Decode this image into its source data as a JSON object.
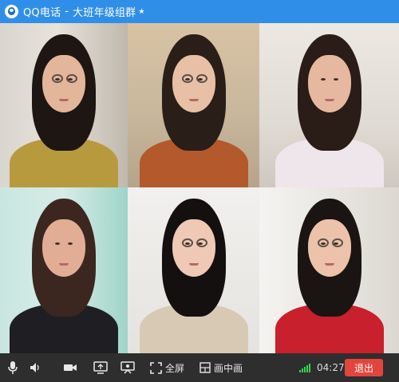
{
  "window": {
    "app_name": "QQ电话",
    "separator": "-",
    "group_name": "大班年级组群",
    "star": "★"
  },
  "participants": [
    {
      "slot": 1,
      "hair": "#1d1612",
      "skin": "#e3b59a",
      "clothes": "#b89a3e",
      "glasses": true
    },
    {
      "slot": 2,
      "hair": "#2a1e18",
      "skin": "#e8c0a6",
      "clothes": "#b4592b",
      "glasses": true
    },
    {
      "slot": 3,
      "hair": "#2a1c16",
      "skin": "#e6b8a0",
      "clothes": "#efe6ec",
      "glasses": false
    },
    {
      "slot": 4,
      "hair": "#3b2720",
      "skin": "#e1ae95",
      "clothes": "#1f1f23",
      "glasses": false
    },
    {
      "slot": 5,
      "hair": "#151010",
      "skin": "#efc9b5",
      "clothes": "#d7c9b4",
      "glasses": true
    },
    {
      "slot": 6,
      "hair": "#1a1412",
      "skin": "#ecc2aa",
      "clothes": "#c8202c",
      "glasses": true
    }
  ],
  "toolbar": {
    "fullscreen_label": "全屏",
    "pip_label": "画中画",
    "call_duration": "04:27",
    "exit_label": "退出",
    "signal_color": "#35d44a",
    "exit_color": "#e2453c"
  }
}
